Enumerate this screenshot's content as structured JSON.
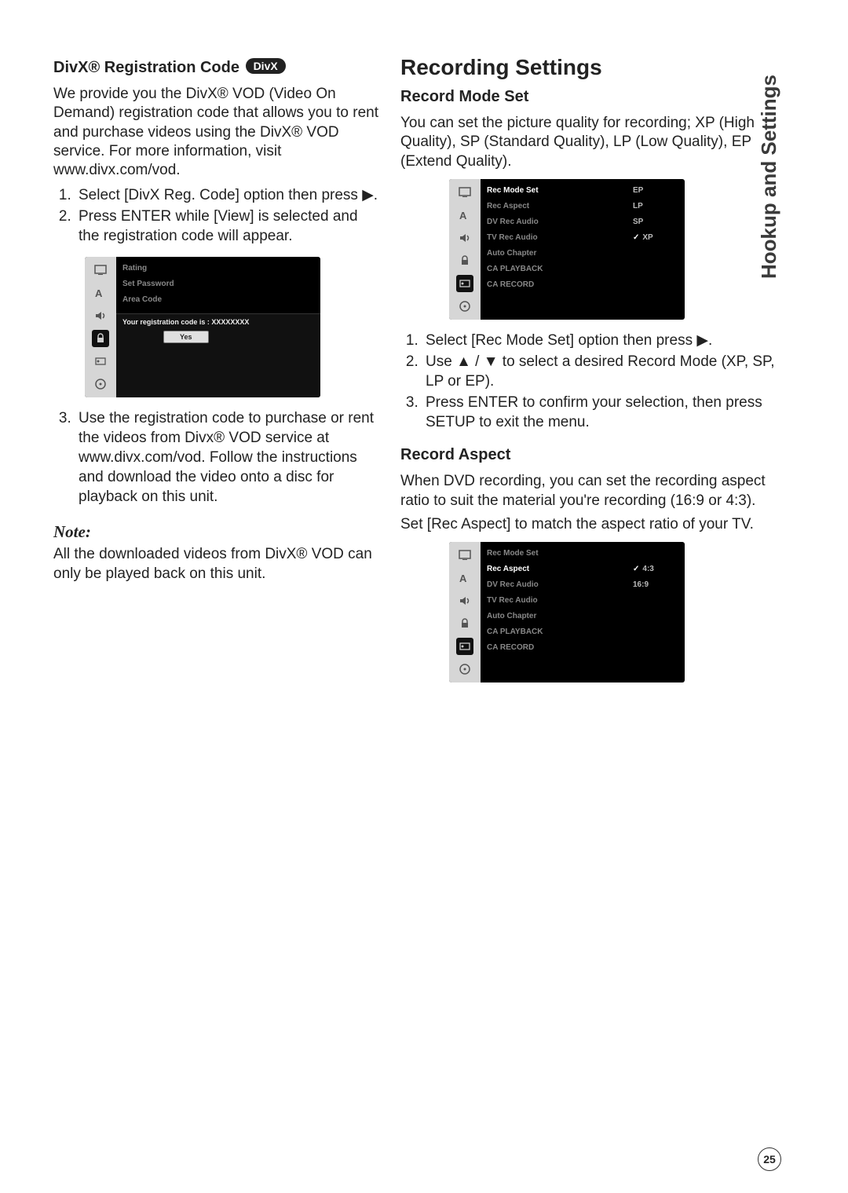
{
  "sideTab": "Hookup and Settings",
  "pageNumber": "25",
  "left": {
    "heading": "DivX® Registration Code ",
    "badge": "DivX",
    "intro": "We provide you the DivX® VOD (Video On Demand) registration code that allows you to rent and purchase videos using the DivX® VOD service. For more information, visit www.divx.com/vod.",
    "steps12": [
      "Select [DivX Reg. Code] option then press ▶.",
      "Press ENTER while [View] is selected and the registration code will appear."
    ],
    "step3": "Use the registration code to purchase or rent the videos from Divx® VOD service at www.divx.com/vod. Follow the instructions and download the video onto a disc for playback on this unit.",
    "noteLabel": "Note:",
    "noteBody": "All the downloaded videos from DivX® VOD can only be played back on this unit.",
    "osd": {
      "menuItems": [
        "Rating",
        "Set Password",
        "Area Code"
      ],
      "regLine": "Your registration code is : XXXXXXXX",
      "yes": "Yes"
    }
  },
  "right": {
    "mainHeading": "Recording Settings",
    "recMode": {
      "heading": "Record Mode Set",
      "intro": "You can set the picture quality for recording; XP (High Quality), SP (Standard Quality), LP (Low Quality), EP (Extend Quality).",
      "steps": [
        "Select [Rec Mode Set] option then press ▶.",
        "Use ▲ / ▼ to select a desired Record Mode (XP, SP, LP or EP).",
        "Press ENTER to confirm your selection, then press SETUP to exit the menu."
      ],
      "osd": {
        "menuItems": [
          "Rec Mode Set",
          "Rec Aspect",
          "DV Rec Audio",
          "TV Rec Audio",
          "Auto Chapter",
          "CA PLAYBACK",
          "CA RECORD"
        ],
        "options": [
          "EP",
          "LP",
          "SP",
          "XP"
        ],
        "selectedIndex": 3,
        "highlightIndex": 0
      }
    },
    "recAspect": {
      "heading": "Record Aspect",
      "p1": "When DVD recording, you can set the recording aspect ratio to suit the material you're recording (16:9 or 4:3).",
      "p2": "Set [Rec Aspect] to match the aspect ratio of your TV.",
      "osd": {
        "menuItems": [
          "Rec Mode Set",
          "Rec Aspect",
          "DV Rec Audio",
          "TV Rec Audio",
          "Auto Chapter",
          "CA PLAYBACK",
          "CA RECORD"
        ],
        "options": [
          "4:3",
          "16:9"
        ],
        "selectedIndex": 0,
        "highlightIndex": 1
      }
    }
  }
}
